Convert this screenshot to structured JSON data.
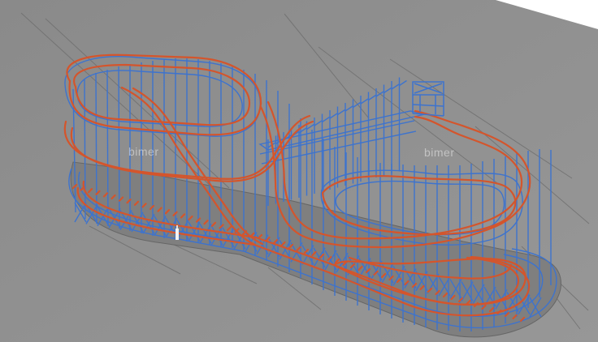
{
  "scene": {
    "background_color": "#8e8e8e",
    "corner_color": "#ffffff",
    "structure_color": "#3b78d8",
    "track_color": "#d9572b",
    "shadow_color": "#6f6f6f"
  },
  "watermarks": {
    "left": "bimer",
    "right": "bimer"
  }
}
